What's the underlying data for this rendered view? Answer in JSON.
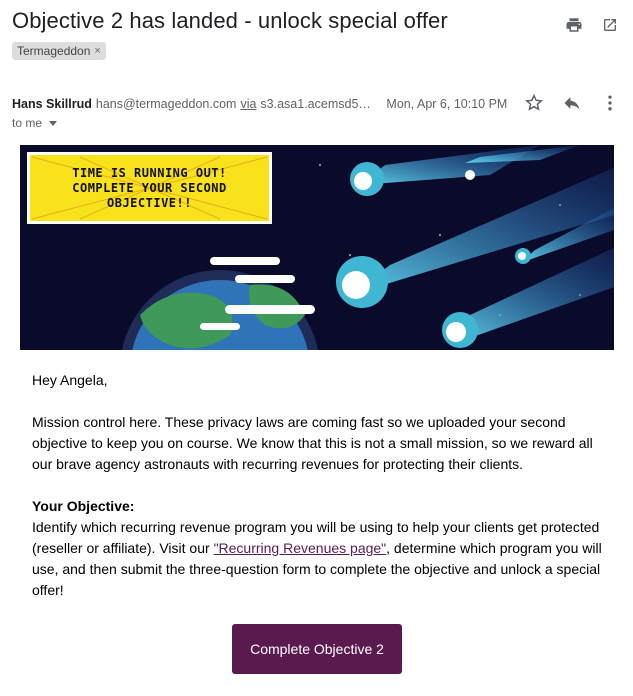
{
  "email": {
    "subject": "Objective 2 has landed - unlock special offer",
    "label": "Termageddon",
    "label_remove": "×",
    "sender": {
      "name": "Hans Skillrud",
      "email": "hans@termageddon.com",
      "via_word": "via",
      "via_host": "s3.asa1.acemsd5…",
      "date": "Mon, Apr 6, 10:10 PM"
    },
    "to_label": "to me",
    "banner": {
      "lines": [
        "TIME IS RUNNING OUT!",
        "COMPLETE YOUR SECOND",
        "OBJECTIVE!!"
      ]
    },
    "body": {
      "greeting": "Hey Angela,",
      "paragraph1": "Mission control here. These privacy laws are coming fast so we uploaded your second objective to keep you on course. We know that this is not a small mission, so we reward all our brave agency astronauts with recurring revenues for protecting their clients.",
      "objective_heading": "Your Objective:",
      "objective_text_before": "Identify which recurring revenue program you will be using to help your clients get protected (reseller or affiliate). Visit our ",
      "objective_link": "\"Recurring Revenues page\"",
      "objective_text_after": ", determine which program you will use, and then submit the three-question form to complete the objective and unlock a special offer!"
    },
    "cta_label": "Complete Objective 2"
  },
  "icons": {
    "print": "print-icon",
    "open_new_window": "open-in-new-window-icon",
    "star": "star-icon",
    "reply": "reply-icon",
    "more": "more-vertical-icon"
  },
  "colors": {
    "cta_background": "#5b1a4e",
    "link": "#5a1a55",
    "banner_background": "#0a0a2a",
    "banner_box": "#f7e21b"
  }
}
